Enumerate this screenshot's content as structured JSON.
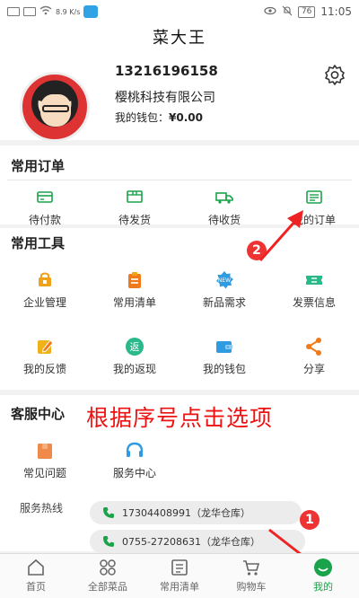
{
  "status_bar": {
    "speed": "8.9 K/s",
    "battery": "76",
    "time": "11:05"
  },
  "title": "菜大王",
  "profile": {
    "phone": "13216196158",
    "company": "樱桃科技有限公司",
    "wallet_label": "我的钱包：",
    "wallet_amount": "¥0.00"
  },
  "orders": {
    "title": "常用订单",
    "items": [
      {
        "label": "待付款",
        "icon": "wallet-card-icon"
      },
      {
        "label": "待发货",
        "icon": "package-icon"
      },
      {
        "label": "待收货",
        "icon": "delivery-truck-icon"
      },
      {
        "label": "我的订单",
        "icon": "order-list-icon"
      }
    ]
  },
  "tools": {
    "title": "常用工具",
    "items": [
      {
        "label": "企业管理",
        "icon": "enterprise-icon"
      },
      {
        "label": "常用清单",
        "icon": "clipboard-icon"
      },
      {
        "label": "新品需求",
        "icon": "new-badge-icon"
      },
      {
        "label": "发票信息",
        "icon": "ticket-icon"
      },
      {
        "label": "我的反馈",
        "icon": "edit-feedback-icon"
      },
      {
        "label": "我的返现",
        "icon": "cashback-icon",
        "glyph": "返"
      },
      {
        "label": "我的钱包",
        "icon": "wallet-icon"
      },
      {
        "label": "分享",
        "icon": "share-icon"
      }
    ]
  },
  "service": {
    "title": "客服中心",
    "items": [
      {
        "label": "常见问题",
        "icon": "faq-box-icon"
      },
      {
        "label": "服务中心",
        "icon": "headset-icon"
      }
    ],
    "hotline_label": "服务热线",
    "hotlines": [
      "17304408991（龙华仓库）",
      "0755-27208631（龙华仓库）"
    ]
  },
  "annotation": {
    "text": "根据序号点击选项",
    "badge_1": "1",
    "badge_2": "2"
  },
  "tabbar": {
    "items": [
      {
        "label": "首页",
        "icon": "home-icon"
      },
      {
        "label": "全部菜品",
        "icon": "grid-categories-icon"
      },
      {
        "label": "常用清单",
        "icon": "list-icon"
      },
      {
        "label": "购物车",
        "icon": "cart-icon"
      },
      {
        "label": "我的",
        "icon": "profile-smile-icon",
        "active": true
      }
    ]
  },
  "colors": {
    "accent_green": "#1aa34a",
    "annotation_red": "#e11111",
    "icon_orange": "#f0a21a",
    "icon_blue": "#2f9be0"
  }
}
